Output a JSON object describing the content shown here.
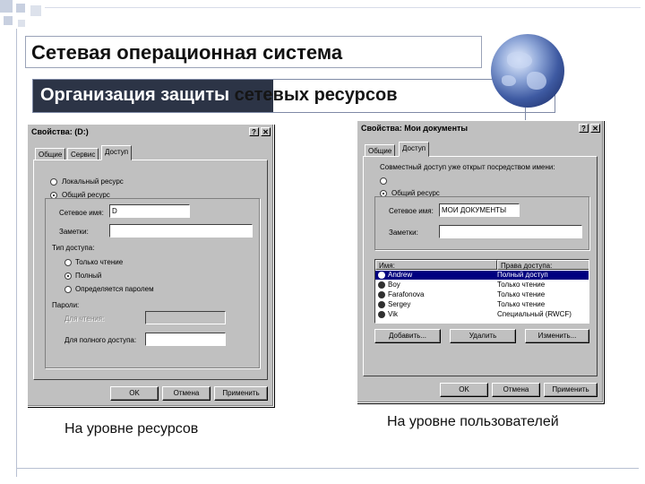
{
  "slide": {
    "title": "Сетевая операционная система",
    "subtitle_part1": "Организация защиты",
    "subtitle_part2": " сетевых ресурсов",
    "caption_left": "На уровне ресурсов",
    "caption_right": "На уровне пользователей"
  },
  "dialog1": {
    "title": "Свойства: (D:)",
    "help_glyph": "?",
    "close_glyph": "✕",
    "tabs": [
      "Общие",
      "Сервис",
      "Доступ"
    ],
    "radio_local": "Локальный ресурс",
    "radio_shared": "Общий ресурс",
    "share_name_label": "Сетевое имя:",
    "share_name_value": "D",
    "comment_label": "Заметки:",
    "comment_value": "",
    "access_type_label": "Тип доступа:",
    "access_readonly": "Только чтение",
    "access_full": "Полный",
    "access_depends": "Определяется паролем",
    "passwords_label": "Пароли:",
    "password_read_label": "Для чтения:",
    "password_full_label": "Для полного доступа:",
    "ok": "OK",
    "cancel": "Отмена",
    "apply": "Применить"
  },
  "dialog2": {
    "title": "Свойства: Мои документы",
    "help_glyph": "?",
    "close_glyph": "✕",
    "tabs": [
      "Общие",
      "Доступ"
    ],
    "radio_local": "Совместный доступ уже открыт посредством имени:",
    "radio_shared": "Общий ресурс",
    "share_name_label": "Сетевое имя:",
    "share_name_value": "МОИ ДОКУМЕНТЫ",
    "comment_label": "Заметки:",
    "comment_value": "",
    "col_name": "Имя:",
    "col_rights": "Права доступа:",
    "users": [
      {
        "name": "Andrew",
        "rights": "Полный доступ",
        "selected": true
      },
      {
        "name": "Boy",
        "rights": "Только чтение",
        "selected": false
      },
      {
        "name": "Farafonova",
        "rights": "Только чтение",
        "selected": false
      },
      {
        "name": "Sergey",
        "rights": "Только чтение",
        "selected": false
      },
      {
        "name": "Vik",
        "rights": "Специальный (RWCF)",
        "selected": false
      }
    ],
    "add": "Добавить...",
    "remove": "Удалить",
    "edit": "Изменить...",
    "ok": "OK",
    "cancel": "Отмена",
    "apply": "Применить"
  }
}
